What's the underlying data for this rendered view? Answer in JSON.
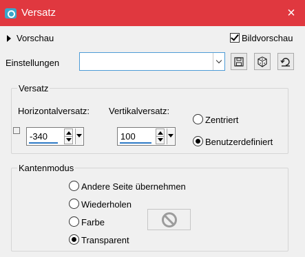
{
  "window": {
    "title": "Versatz",
    "close_icon": "×"
  },
  "preview": {
    "label": "Vorschau",
    "checkbox_label": "Bildvorschau",
    "checked": true
  },
  "settings": {
    "label": "Einstellungen",
    "value": ""
  },
  "offset": {
    "group_label": "Versatz",
    "horizontal": {
      "label": "Horizontalversatz:",
      "value": "-340"
    },
    "vertical": {
      "label": "Vertikalversatz:",
      "value": "100"
    },
    "modes": [
      {
        "label": "Zentriert",
        "selected": false
      },
      {
        "label": "Benutzerdefiniert",
        "selected": true
      }
    ]
  },
  "edge_mode": {
    "group_label": "Kantenmodus",
    "options": [
      {
        "label": "Andere Seite übernehmen",
        "selected": false
      },
      {
        "label": "Wiederholen",
        "selected": false
      },
      {
        "label": "Farbe",
        "selected": false
      },
      {
        "label": "Transparent",
        "selected": true
      }
    ]
  }
}
